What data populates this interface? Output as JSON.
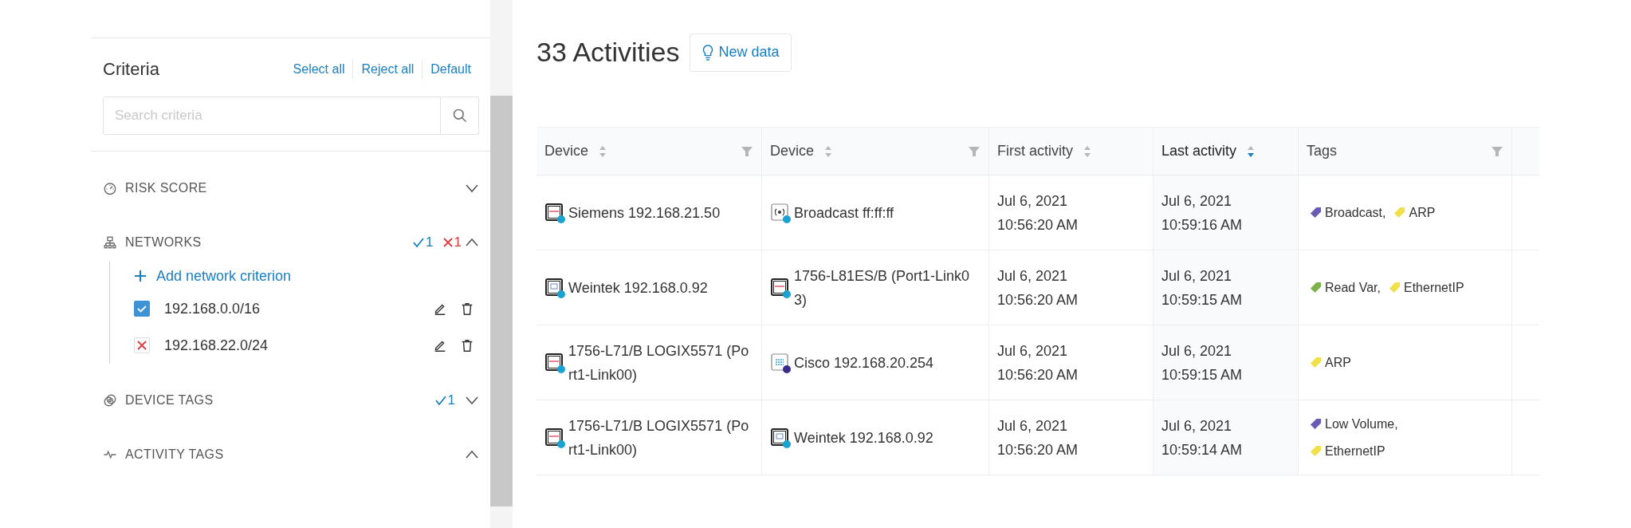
{
  "criteria": {
    "title": "Criteria",
    "actions": [
      "Select all",
      "Reject all",
      "Default"
    ],
    "search": {
      "placeholder": "Search criteria"
    },
    "sections": [
      {
        "label": "RISK SCORE",
        "expanded": false
      },
      {
        "label": "NETWORKS",
        "expanded": true,
        "accepted_count": "1",
        "rejected_count": "1",
        "add_label": "Add network criterion",
        "items": [
          {
            "label": "192.168.0.0/16",
            "checked": true,
            "rejected": false
          },
          {
            "label": "192.168.22.0/24",
            "checked": false,
            "rejected": true
          }
        ]
      },
      {
        "label": "DEVICE TAGS",
        "expanded": false,
        "accepted_count": "1"
      },
      {
        "label": "ACTIVITY TAGS",
        "expanded": true
      }
    ]
  },
  "activities": {
    "title": "33 Activities",
    "new_data_label": "New data",
    "table": {
      "columns": [
        {
          "label": "Device",
          "sortable": true,
          "sorted": false,
          "filterable": true
        },
        {
          "label": "Device",
          "sortable": true,
          "sorted": false,
          "filterable": true
        },
        {
          "label": "First activity",
          "sortable": true,
          "sorted": false,
          "filterable": false
        },
        {
          "label": "Last activity",
          "sortable": true,
          "sorted": true,
          "filterable": false
        },
        {
          "label": "Tags",
          "sortable": false,
          "sorted": false,
          "filterable": true
        }
      ],
      "rows": [
        {
          "source": {
            "kind": "plc",
            "name": "Siemens 192.168.21.50",
            "color": "#1aa3d1"
          },
          "destination": {
            "kind": "broadcast",
            "name": "Broadcast ff:ff:ff",
            "color": "#1aa3d1"
          },
          "first": [
            "Jul 6, 2021",
            "10:56:20 AM"
          ],
          "last": [
            "Jul 6, 2021",
            "10:59:16 AM"
          ],
          "tags": [
            {
              "label": "Broadcast,",
              "color": "#6b5bb5"
            },
            {
              "label": "ARP",
              "color": "#f1e04a"
            }
          ]
        },
        {
          "source": {
            "kind": "hmi",
            "name": "Weintek 192.168.0.92",
            "color": "#1aa3d1"
          },
          "destination": {
            "kind": "plc",
            "name": "1756-L81ES/B (Port1-Link03)",
            "color": "#1aa3d1"
          },
          "first": [
            "Jul 6, 2021",
            "10:56:20 AM"
          ],
          "last": [
            "Jul 6, 2021",
            "10:59:15 AM"
          ],
          "tags": [
            {
              "label": "Read Var,",
              "color": "#7cb24a"
            },
            {
              "label": "EthernetIP",
              "color": "#f1e04a"
            }
          ]
        },
        {
          "source": {
            "kind": "plc",
            "name": "1756-L71/B LOGIX5571 (Port1-Link00)",
            "color": "#1aa3d1"
          },
          "destination": {
            "kind": "switch",
            "name": "Cisco 192.168.20.254",
            "color": "#3a2a8c"
          },
          "first": [
            "Jul 6, 2021",
            "10:56:20 AM"
          ],
          "last": [
            "Jul 6, 2021",
            "10:59:15 AM"
          ],
          "tags": [
            {
              "label": "ARP",
              "color": "#f1e04a"
            }
          ]
        },
        {
          "source": {
            "kind": "plc",
            "name": "1756-L71/B LOGIX5571 (Port1-Link00)",
            "color": "#1aa3d1"
          },
          "destination": {
            "kind": "hmi",
            "name": "Weintek 192.168.0.92",
            "color": "#1aa3d1"
          },
          "first": [
            "Jul 6, 2021",
            "10:56:20 AM"
          ],
          "last": [
            "Jul 6, 2021",
            "10:59:14 AM"
          ],
          "tags": [
            {
              "label": "Low Volume,",
              "color": "#6b5bb5"
            },
            {
              "label": "EthernetIP",
              "color": "#f1e04a"
            }
          ]
        }
      ]
    }
  }
}
